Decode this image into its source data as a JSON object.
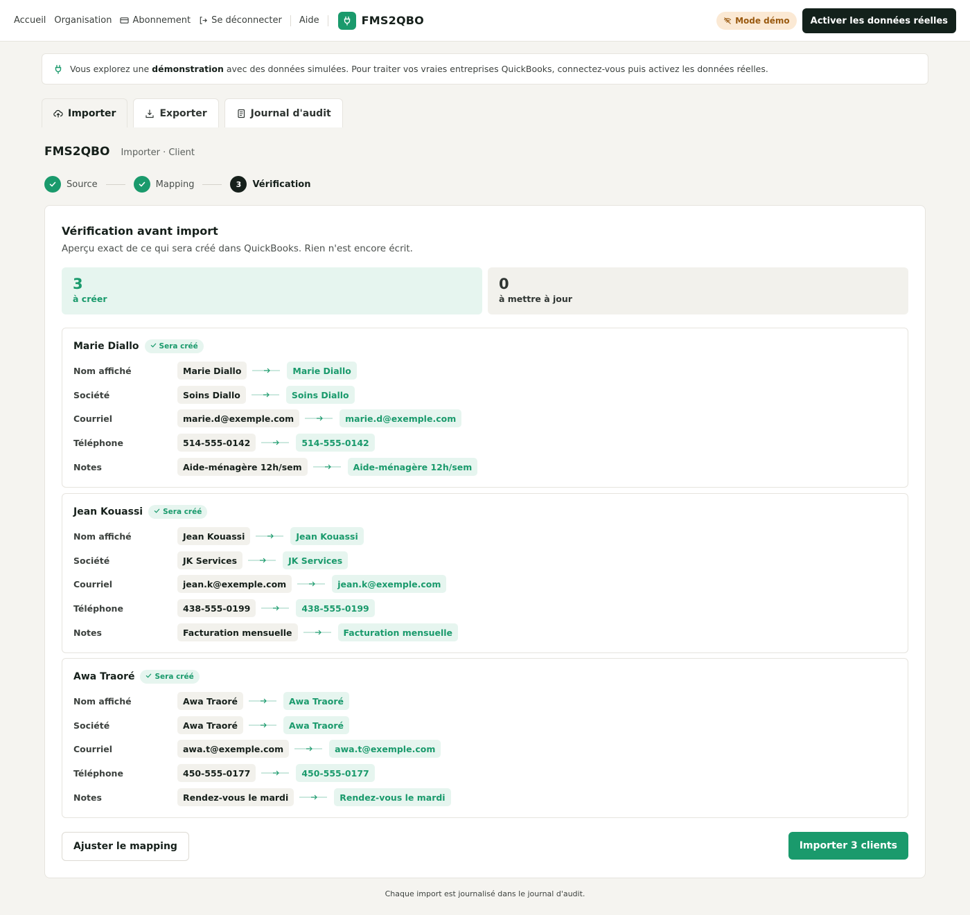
{
  "nav": {
    "home": "Accueil",
    "organisation": "Organisation",
    "subscription": "Abonnement",
    "logout": "Se déconnecter",
    "help": "Aide",
    "brand": "FMS2QBO",
    "demo_mode": "Mode démo",
    "activate": "Activer les données réelles"
  },
  "banner": {
    "before": "Vous explorez une ",
    "bold": "démonstration",
    "after": " avec des données simulées. Pour traiter vos vraies entreprises QuickBooks, connectez-vous puis activez les données réelles."
  },
  "tabs": [
    {
      "label": "Importer"
    },
    {
      "label": "Exporter"
    },
    {
      "label": "Journal d'audit"
    }
  ],
  "breadcrumb": {
    "brand": "FMS2QBO",
    "path": "Importer · Client"
  },
  "steps": [
    {
      "label": "Source"
    },
    {
      "label": "Mapping"
    },
    {
      "label": "Vérification",
      "number": "3"
    }
  ],
  "review": {
    "title": "Vérification avant import",
    "subtitle": "Aperçu exact de ce qui sera créé dans QuickBooks. Rien n'est encore écrit.",
    "create_count": "3",
    "create_label": "à créer",
    "update_count": "0",
    "update_label": "à mettre à jour",
    "badge": "Sera créé",
    "field_labels": [
      "Nom affiché",
      "Société",
      "Courriel",
      "Téléphone",
      "Notes"
    ],
    "records": [
      {
        "name": "Marie Diallo",
        "values": [
          "Marie Diallo",
          "Soins Diallo",
          "marie.d@exemple.com",
          "514-555-0142",
          "Aide-ménagère 12h/sem"
        ]
      },
      {
        "name": "Jean Kouassi",
        "values": [
          "Jean Kouassi",
          "JK Services",
          "jean.k@exemple.com",
          "438-555-0199",
          "Facturation mensuelle"
        ]
      },
      {
        "name": "Awa Traoré",
        "values": [
          "Awa Traoré",
          "Awa Traoré",
          "awa.t@exemple.com",
          "450-555-0177",
          "Rendez-vous le mardi"
        ]
      }
    ],
    "adjust_button": "Ajuster le mapping",
    "import_button": "Importer 3 clients"
  },
  "footer": "Chaque import est journalisé dans le journal d'audit.",
  "colors": {
    "accent": "#1a9a6c",
    "dark": "#13211b",
    "demo": "#9a5a10"
  }
}
